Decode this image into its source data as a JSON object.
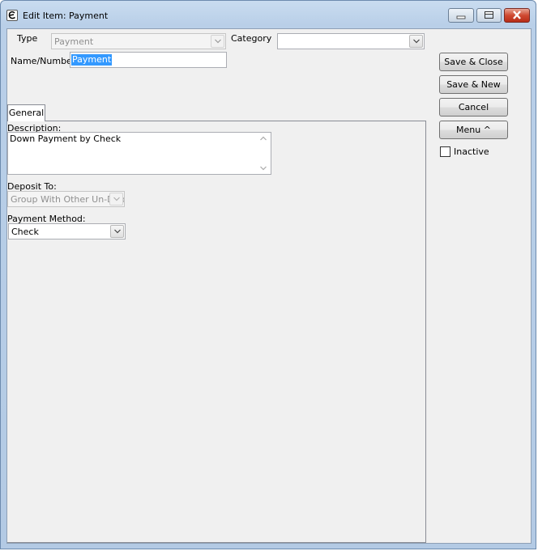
{
  "window": {
    "title": "Edit Item: Payment",
    "controls": {
      "minimize": "minimize",
      "maximize": "maximize",
      "close": "close"
    }
  },
  "form": {
    "type_label": "Type",
    "type_value": "Payment",
    "category_label": "Category",
    "category_value": "",
    "name_label": "Name/Number",
    "name_value": "Payment"
  },
  "buttons": {
    "save_close": "Save & Close",
    "save_new": "Save & New",
    "cancel": "Cancel",
    "menu": "Menu ^"
  },
  "inactive": {
    "label": "Inactive",
    "checked": false
  },
  "tabs": [
    {
      "label": "General",
      "active": true
    }
  ],
  "general": {
    "description_label": "Description:",
    "description_value": "Down Payment by Check",
    "deposit_label": "Deposit To:",
    "deposit_value": "Group With Other Un-Dep",
    "payment_method_label": "Payment Method:",
    "payment_method_value": "Check"
  },
  "colors": {
    "selection": "#3399ff",
    "close_button": "#cf4a31",
    "title_bar": "#c9dcf0"
  }
}
